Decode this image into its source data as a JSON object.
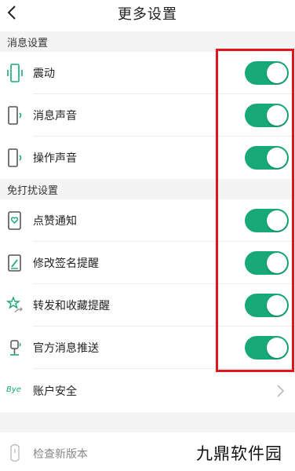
{
  "header": {
    "title": "更多设置"
  },
  "sections": [
    {
      "label": "消息设置",
      "items": [
        {
          "label": "震动",
          "icon": "vibration-phone-icon",
          "toggle_on": true
        },
        {
          "label": "消息声音",
          "icon": "phone-sound-icon",
          "toggle_on": true
        },
        {
          "label": "操作声音",
          "icon": "phone-sound-icon",
          "toggle_on": true
        }
      ]
    },
    {
      "label": "免打扰设置",
      "items": [
        {
          "label": "点赞通知",
          "icon": "heart-phone-icon",
          "toggle_on": true
        },
        {
          "label": "修改签名提醒",
          "icon": "edit-signature-icon",
          "toggle_on": true
        },
        {
          "label": "转发和收藏提醒",
          "icon": "star-share-icon",
          "toggle_on": true
        },
        {
          "label": "官方消息推送",
          "icon": "megaphone-icon",
          "toggle_on": true
        }
      ]
    }
  ],
  "account_security": {
    "label": "账户安全",
    "icon_text": "Bye"
  },
  "check_update": {
    "label": "检查新版本"
  },
  "watermark": "九鼎软件园",
  "colors": {
    "toggle_on": "#17a978",
    "highlight": "#e0141b",
    "section_bg": "#f4f4f4"
  }
}
